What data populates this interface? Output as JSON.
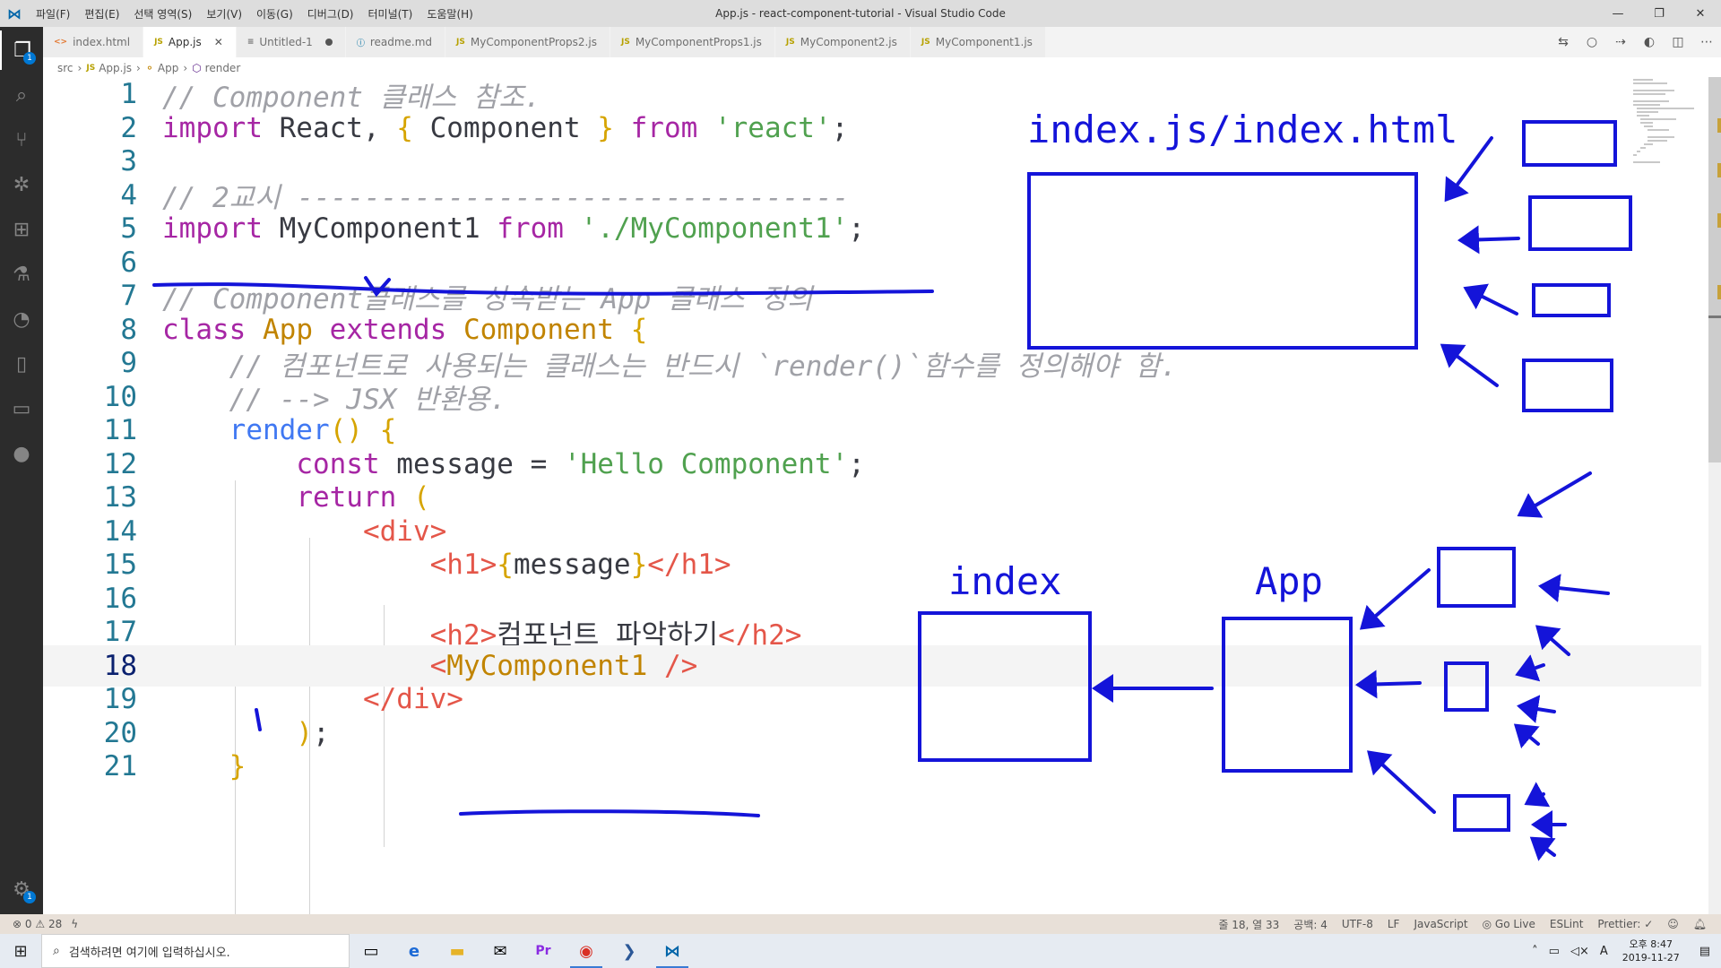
{
  "window": {
    "title": "App.js - react-component-tutorial - Visual Studio Code",
    "menu": [
      "파일(F)",
      "편집(E)",
      "선택 영역(S)",
      "보기(V)",
      "이동(G)",
      "디버그(D)",
      "터미널(T)",
      "도움말(H)"
    ]
  },
  "tabs": [
    {
      "label": "index.html",
      "icon": "html-file-icon",
      "iconText": "<>"
    },
    {
      "label": "App.js",
      "icon": "js-file-icon",
      "iconText": "JS",
      "active": true
    },
    {
      "label": "Untitled-1",
      "icon": "plain-file-icon",
      "iconText": "≡",
      "dirty": true
    },
    {
      "label": "readme.md",
      "icon": "info-file-icon",
      "iconText": "ⓘ"
    },
    {
      "label": "MyComponentProps2.js",
      "icon": "js-file-icon",
      "iconText": "JS"
    },
    {
      "label": "MyComponentProps1.js",
      "icon": "js-file-icon",
      "iconText": "JS"
    },
    {
      "label": "MyComponent2.js",
      "icon": "js-file-icon",
      "iconText": "JS"
    },
    {
      "label": "MyComponent1.js",
      "icon": "js-file-icon",
      "iconText": "JS"
    }
  ],
  "breadcrumb": {
    "folder": "src",
    "file": "App.js",
    "class": "App",
    "method": "render"
  },
  "code_lines": [
    {
      "n": "1",
      "tokens": [
        [
          "com",
          "// Component 클래스 참조."
        ]
      ]
    },
    {
      "n": "2",
      "tokens": [
        [
          "kw",
          "import"
        ],
        [
          "plain",
          " React, "
        ],
        [
          "brace",
          "{"
        ],
        [
          "plain",
          " Component "
        ],
        [
          "brace",
          "}"
        ],
        [
          "plain",
          " "
        ],
        [
          "kw",
          "from"
        ],
        [
          "plain",
          " "
        ],
        [
          "str",
          "'react'"
        ],
        [
          "plain",
          ";"
        ]
      ]
    },
    {
      "n": "3",
      "tokens": []
    },
    {
      "n": "4",
      "tokens": [
        [
          "com",
          "// 2교시 ---------------------------------"
        ]
      ]
    },
    {
      "n": "5",
      "tokens": [
        [
          "kw",
          "import"
        ],
        [
          "plain",
          " MyComponent1 "
        ],
        [
          "kw",
          "from"
        ],
        [
          "plain",
          " "
        ],
        [
          "str",
          "'./MyComponent1'"
        ],
        [
          "plain",
          ";"
        ]
      ]
    },
    {
      "n": "6",
      "tokens": []
    },
    {
      "n": "7",
      "tokens": [
        [
          "com",
          "// Component클래스를 상속받는 App 클래스 정의"
        ]
      ]
    },
    {
      "n": "8",
      "tokens": [
        [
          "kw",
          "class"
        ],
        [
          "plain",
          " "
        ],
        [
          "cls",
          "App"
        ],
        [
          "plain",
          " "
        ],
        [
          "kw",
          "extends"
        ],
        [
          "plain",
          " "
        ],
        [
          "cls",
          "Component"
        ],
        [
          "plain",
          " "
        ],
        [
          "brace",
          "{"
        ]
      ]
    },
    {
      "n": "9",
      "tokens": [
        [
          "plain",
          "    "
        ],
        [
          "com",
          "// 컴포넌트로 사용되는 클래스는 반드시 `render()`함수를 정의해야 함."
        ]
      ]
    },
    {
      "n": "10",
      "tokens": [
        [
          "plain",
          "    "
        ],
        [
          "com",
          "// --> JSX 반환용."
        ]
      ]
    },
    {
      "n": "11",
      "tokens": [
        [
          "plain",
          "    "
        ],
        [
          "fn",
          "render"
        ],
        [
          "brace",
          "()"
        ],
        [
          "plain",
          " "
        ],
        [
          "brace",
          "{"
        ]
      ]
    },
    {
      "n": "12",
      "tokens": [
        [
          "plain",
          "        "
        ],
        [
          "kw",
          "const"
        ],
        [
          "plain",
          " message = "
        ],
        [
          "str",
          "'Hello Component'"
        ],
        [
          "plain",
          ";"
        ]
      ]
    },
    {
      "n": "13",
      "tokens": [
        [
          "plain",
          "        "
        ],
        [
          "kw",
          "return"
        ],
        [
          "plain",
          " "
        ],
        [
          "brace",
          "("
        ]
      ]
    },
    {
      "n": "14",
      "tokens": [
        [
          "plain",
          "            "
        ],
        [
          "tag",
          "<div>"
        ]
      ]
    },
    {
      "n": "15",
      "tokens": [
        [
          "plain",
          "                "
        ],
        [
          "tag",
          "<h1>"
        ],
        [
          "brace",
          "{"
        ],
        [
          "plain",
          "message"
        ],
        [
          "brace",
          "}"
        ],
        [
          "tag",
          "</h1>"
        ]
      ]
    },
    {
      "n": "16",
      "tokens": []
    },
    {
      "n": "17",
      "tokens": [
        [
          "plain",
          "                "
        ],
        [
          "tag",
          "<h2>"
        ],
        [
          "plain",
          "컴포넌트 파악하기"
        ],
        [
          "tag",
          "</h2>"
        ]
      ]
    },
    {
      "n": "18",
      "tokens": [
        [
          "plain",
          "                "
        ],
        [
          "tag",
          "<"
        ],
        [
          "cls",
          "MyComponent1"
        ],
        [
          "plain",
          " "
        ],
        [
          "tag",
          "/>"
        ]
      ],
      "current": true
    },
    {
      "n": "19",
      "tokens": [
        [
          "plain",
          "            "
        ],
        [
          "tag",
          "</div>"
        ]
      ]
    },
    {
      "n": "20",
      "tokens": [
        [
          "plain",
          "        "
        ],
        [
          "brace",
          ")"
        ],
        [
          "plain",
          ";"
        ]
      ]
    },
    {
      "n": "21",
      "tokens": [
        [
          "plain",
          "    "
        ],
        [
          "brace",
          "}"
        ]
      ]
    }
  ],
  "annotations": {
    "label_top": "index.js/index.html",
    "label_index": "index",
    "label_app": "App"
  },
  "statusbar": {
    "errors": "0",
    "warnings": "28",
    "position": "줄 18, 열 33",
    "spaces": "공백: 4",
    "encoding": "UTF-8",
    "eol": "LF",
    "language": "JavaScript",
    "golive": "Go Live",
    "eslint": "ESLint",
    "prettier": "Prettier: ✓"
  },
  "taskbar": {
    "search_placeholder": "검색하려면 여기에 입력하십시오.",
    "time": "오후 8:47",
    "date": "2019-11-27",
    "ime": "A"
  },
  "colors": {
    "annotation": "#1414d9",
    "line_number": "#237893",
    "activitybar": "#2c2c2c"
  }
}
